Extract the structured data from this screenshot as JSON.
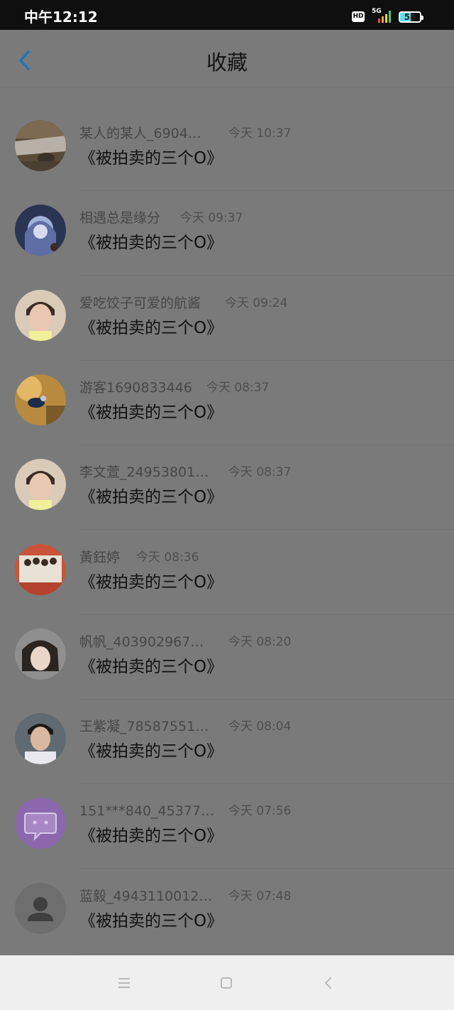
{
  "status_bar": {
    "time": "中午12:12",
    "hd_badge": "HD",
    "network": "5G",
    "battery_level": "54",
    "battery_fraction": 0.54
  },
  "nav": {
    "back_icon": "chevron-left-icon",
    "title": "收藏"
  },
  "favorites": [
    {
      "name": "某人的某人_6904…",
      "time": "今天 10:37",
      "book": "《被拍卖的三个O》",
      "avatar": "waterfall-photo"
    },
    {
      "name": "相遇总是缘分",
      "time": "今天 09:37",
      "book": "《被拍卖的三个O》",
      "avatar": "anime-girl-photo"
    },
    {
      "name": "爱吃饺子可爱的航酱",
      "time": "今天 09:24",
      "book": "《被拍卖的三个O》",
      "avatar": "boy-portrait-photo"
    },
    {
      "name": "游客1690833446",
      "time": "今天 08:37",
      "book": "《被拍卖的三个O》",
      "avatar": "jewelry-photo"
    },
    {
      "name": "李文萱_24953801…",
      "time": "今天 08:37",
      "book": "《被拍卖的三个O》",
      "avatar": "boy-portrait-photo"
    },
    {
      "name": "黃鈺婷",
      "time": "今天 08:36",
      "book": "《被拍卖的三个O》",
      "avatar": "group-photo"
    },
    {
      "name": "帆帆_403902967…",
      "time": "今天 08:20",
      "book": "《被拍卖的三个O》",
      "avatar": "girl-portrait-photo"
    },
    {
      "name": "王紫凝_78587551…",
      "time": "今天 08:04",
      "book": "《被拍卖的三个O》",
      "avatar": "man-portrait-photo"
    },
    {
      "name": "151***840_45377…",
      "time": "今天 07:56",
      "book": "《被拍卖的三个O》",
      "avatar": "chat-bubble-icon"
    },
    {
      "name": "蓝毅_4943110012…",
      "time": "今天 07:48",
      "book": "《被拍卖的三个O》",
      "avatar": "default-user-icon"
    }
  ],
  "bottom_nav": {
    "menu_icon": "menu-icon",
    "home_icon": "home-square-icon",
    "back_icon": "back-triangle-icon"
  },
  "colors": {
    "overlay_bg": "#7a7a7a",
    "accent_blue": "#1e73b8",
    "status_bar": "#0f0f0f",
    "nav_bar_bottom": "#efefef"
  }
}
